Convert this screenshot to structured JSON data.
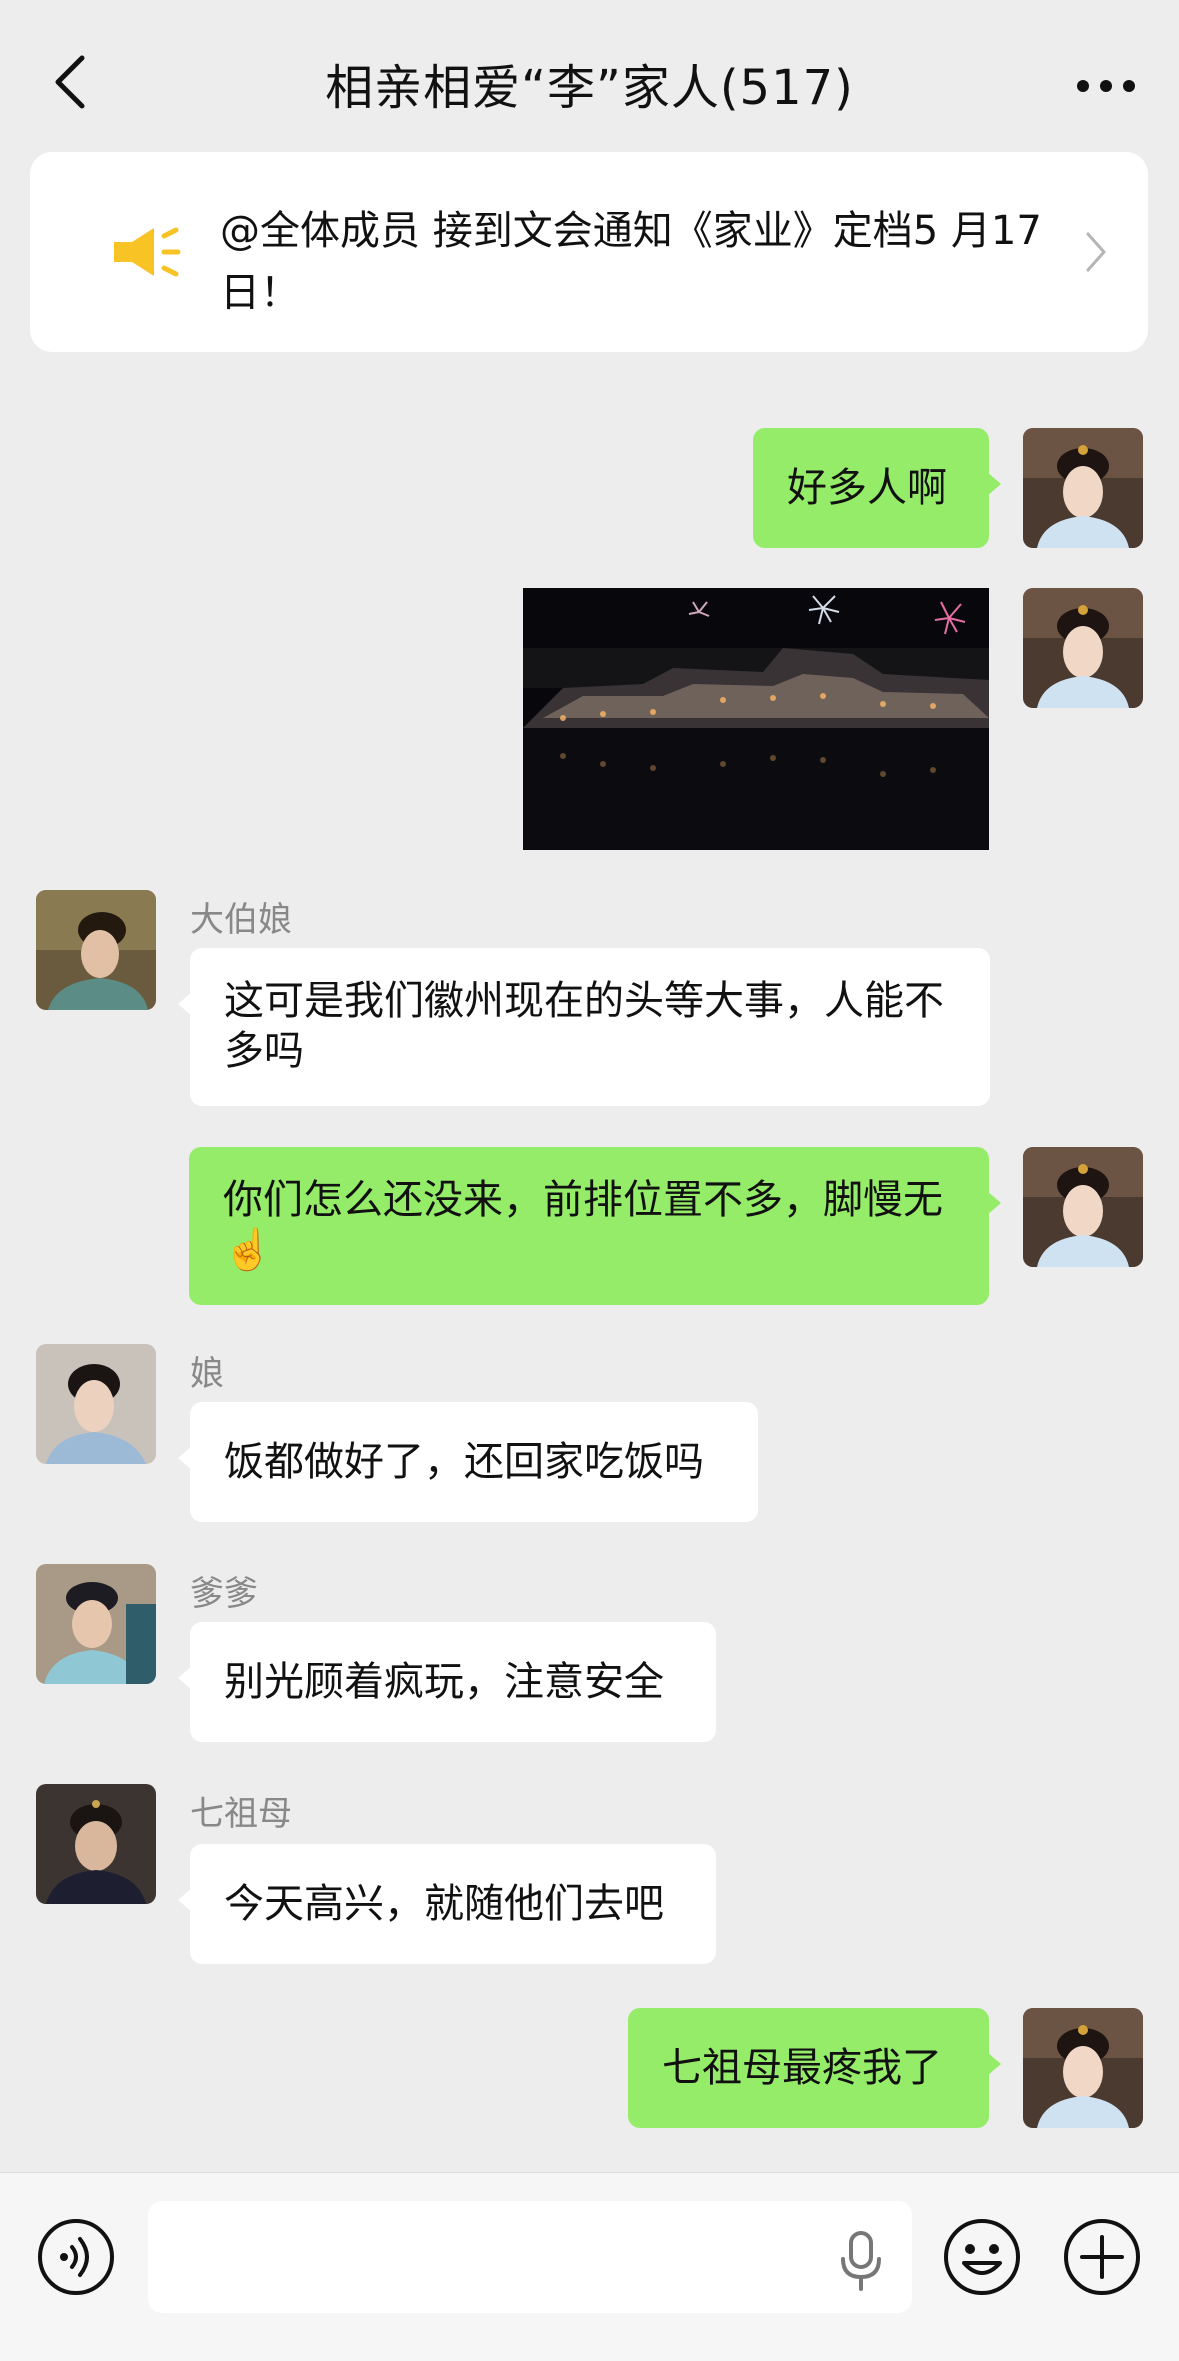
{
  "header": {
    "title": "相亲相爱“李”家人(517)",
    "back_icon": "chevron-left-icon",
    "more_icon": "ellipsis-icon"
  },
  "announcement": {
    "text": "@全体成员  接到文会通知《家业》定档5 月17日！",
    "icon": "speaker-icon",
    "accent": "#f7c325"
  },
  "messages": [
    {
      "sender": "me",
      "type": "text",
      "text": "好多人啊"
    },
    {
      "sender": "me",
      "type": "image",
      "alt": "fireworks-night-photo"
    },
    {
      "sender": "大伯娘",
      "type": "text",
      "text": "这可是我们徽州现在的头等大事，人能不多吗"
    },
    {
      "sender": "me",
      "type": "text",
      "text": "你们怎么还没来，前排位置不多，脚慢无☝️"
    },
    {
      "sender": "娘",
      "type": "text",
      "text": "饭都做好了，还回家吃饭吗"
    },
    {
      "sender": "爹爹",
      "type": "text",
      "text": "别光顾着疯玩，注意安全"
    },
    {
      "sender": "七祖母",
      "type": "text",
      "text": "今天高兴，就随他们去吧"
    },
    {
      "sender": "me",
      "type": "text",
      "text": "七祖母最疼我了"
    }
  ],
  "input_bar": {
    "placeholder": "",
    "icons": [
      "voice-icon",
      "mic-icon",
      "emoji-icon",
      "plus-icon"
    ]
  },
  "colors": {
    "background": "#ededed",
    "self_bubble": "#95ec69",
    "other_bubble": "#ffffff",
    "name_gray": "#888888"
  }
}
